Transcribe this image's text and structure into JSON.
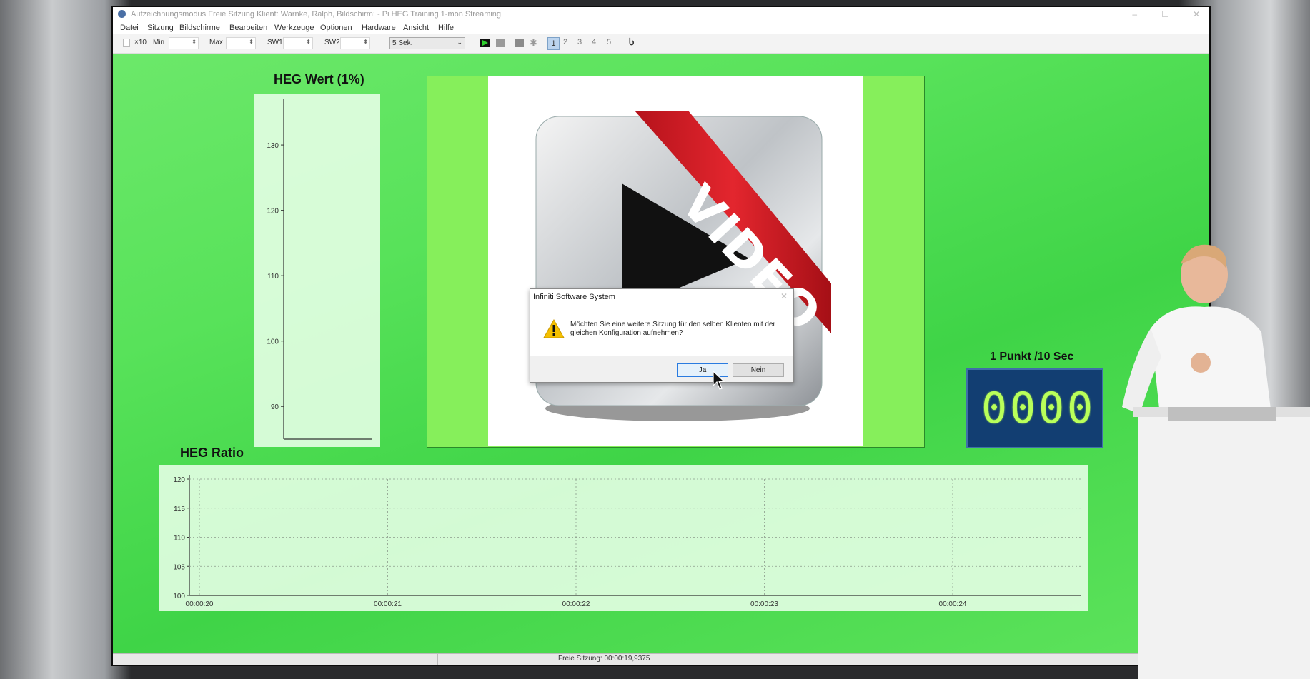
{
  "window": {
    "title": "Aufzeichnungsmodus Freie Sitzung  Klient: Warnke, Ralph, Bildschirm: - Pi HEG Training 1-mon Streaming"
  },
  "menu": [
    "Datei",
    "Sitzung",
    "Bildschirme",
    "Bearbeiten",
    "Werkzeuge",
    "Optionen",
    "Hardware",
    "Ansicht",
    "Hilfe"
  ],
  "toolbar": {
    "x10": "×10",
    "min_label": "Min",
    "max_label": "Max",
    "sw1_label": "SW1",
    "sw2_label": "SW2",
    "interval": "5 Sek.",
    "pages": [
      "1",
      "2",
      "3",
      "4",
      "5"
    ],
    "active_page": "1"
  },
  "heg_wert": {
    "title": "HEG Wert (1%)",
    "y_ticks": [
      "130",
      "120",
      "110",
      "100",
      "90"
    ]
  },
  "heg_ratio": {
    "title": "HEG Ratio"
  },
  "video": {
    "banner_text": "VIDEO"
  },
  "dialog": {
    "title": "Infiniti Software System",
    "message": "Möchten Sie eine weitere Sitzung für den selben Klienten mit der gleichen Konfiguration aufnehmen?",
    "yes": "Ja",
    "no": "Nein"
  },
  "counter": {
    "title": "1 Punkt /10 Sec",
    "digits": [
      "0",
      "0",
      "0",
      "0"
    ]
  },
  "status": {
    "text": "Freie Sitzung: 00:00:19,9375"
  },
  "colors": {
    "green_bg": "#4fdc52",
    "counter_bg": "#123e72",
    "digit": "#b9ff5a"
  },
  "chart_data": [
    {
      "type": "line",
      "title": "HEG Wert (1%)",
      "xlabel": "",
      "ylabel": "",
      "y_ticks": [
        130,
        120,
        110,
        100,
        90
      ],
      "ylim": [
        85,
        137
      ],
      "series": []
    },
    {
      "type": "line",
      "title": "HEG Ratio",
      "xlabel": "",
      "ylabel": "",
      "x_ticks": [
        "00:00:20",
        "00:00:21",
        "00:00:22",
        "00:00:23",
        "00:00:24"
      ],
      "y_ticks": [
        120,
        115,
        110,
        105,
        100
      ],
      "ylim": [
        100,
        120
      ],
      "grid": true,
      "series": []
    }
  ]
}
